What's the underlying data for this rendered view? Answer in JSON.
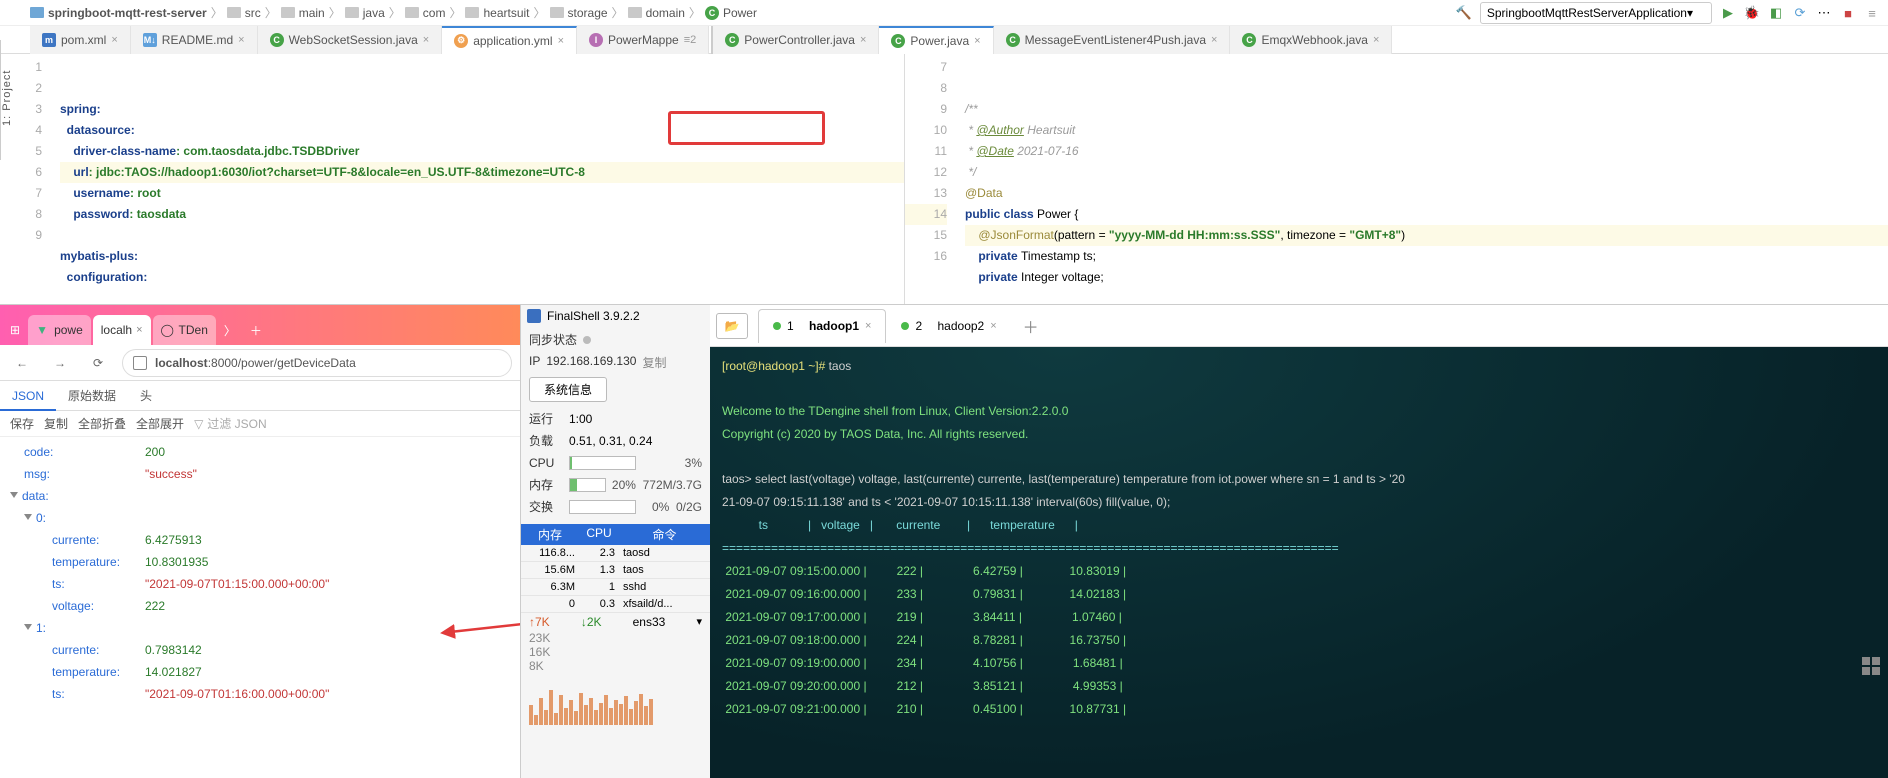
{
  "ide": {
    "sidebar_label": "1: Project",
    "breadcrumbs": [
      "springboot-mqtt-rest-server",
      "src",
      "main",
      "java",
      "com",
      "heartsuit",
      "storage",
      "domain",
      "Power"
    ],
    "run_config": "SpringbootMqttRestServerApplication",
    "editor_tabs_left": [
      {
        "icon": "m",
        "label": "pom.xml",
        "close": true
      },
      {
        "icon": "md",
        "label": "README.md",
        "close": true
      },
      {
        "icon": "c",
        "label": "WebSocketSession.java",
        "close": true
      },
      {
        "icon": "y",
        "label": "application.yml",
        "close": true,
        "active": true
      },
      {
        "icon": "i",
        "label": "PowerMappe",
        "close": true,
        "pin": "≡2"
      }
    ],
    "editor_tabs_right": [
      {
        "icon": "c",
        "label": "PowerController.java",
        "close": true
      },
      {
        "icon": "c",
        "label": "Power.java",
        "close": true,
        "active": true
      },
      {
        "icon": "c",
        "label": "MessageEventListener4Push.java",
        "close": true
      },
      {
        "icon": "c",
        "label": "EmqxWebhook.java",
        "close": true
      }
    ],
    "yml": {
      "lines_no": [
        "1",
        "2",
        "3",
        "4",
        "5",
        "6",
        "7",
        "8",
        "9"
      ],
      "l1": "spring:",
      "l2": "  datasource:",
      "l3a": "    driver-class-name",
      "l3b": ": com.taosdata.jdbc.TSDBDriver",
      "l4a": "    url",
      "l4b": ": jdbc:TAOS://hadoop1:6030/iot?charset=UTF-8&locale=en_US.UTF-8&timezone=UTC-8",
      "l5a": "    username",
      "l5b": ": root",
      "l6a": "    password",
      "l6b": ": taosdata",
      "l7": "",
      "l8": "mybatis-plus:",
      "l9": "  configuration:"
    },
    "java": {
      "lines_no": [
        "7",
        "8",
        "9",
        "10",
        "11",
        "12",
        "13",
        "14",
        "15",
        "16"
      ],
      "l8": "/**",
      "l9a": " * ",
      "l9b": "@Author",
      "l9c": " Heartsuit",
      "l10a": " * ",
      "l10b": "@Date",
      "l10c": " 2021-07-16",
      "l11": " */",
      "l12": "@Data",
      "l13a": "public class ",
      "l13b": "Power {",
      "l14a": "    @JsonFormat",
      "l14b": "(pattern = ",
      "l14c": "\"yyyy-MM-dd HH:mm:ss.SSS\"",
      "l14d": ", timezone = ",
      "l14e": "\"GMT+8\"",
      "l14f": ")",
      "l15a": "    private ",
      "l15b": "Timestamp ts;",
      "l16a": "    private ",
      "l16b": "Integer voltage;"
    }
  },
  "browser": {
    "tabs": [
      {
        "label": "powe",
        "kind": "vue"
      },
      {
        "label": "localh",
        "kind": "page",
        "active": true
      },
      {
        "label": "TDen",
        "kind": "gh"
      }
    ],
    "url_host": "localhost",
    "url_rest": ":8000/power/getDeviceData",
    "json_tabs": [
      "JSON",
      "原始数据",
      "头"
    ],
    "tools": [
      "保存",
      "复制",
      "全部折叠",
      "全部展开"
    ],
    "filter_placeholder": "过滤 JSON",
    "json": {
      "code_k": "code:",
      "code_v": "200",
      "msg_k": "msg:",
      "msg_v": "\"success\"",
      "data_k": "data:",
      "i0": "0:",
      "i0_cur_k": "currente:",
      "i0_cur_v": "6.4275913",
      "i0_tmp_k": "temperature:",
      "i0_tmp_v": "10.8301935",
      "i0_ts_k": "ts:",
      "i0_ts_v": "\"2021-09-07T01:15:00.000+00:00\"",
      "i0_vol_k": "voltage:",
      "i0_vol_v": "222",
      "i1": "1:",
      "i1_cur_k": "currente:",
      "i1_cur_v": "0.7983142",
      "i1_tmp_k": "temperature:",
      "i1_tmp_v": "14.021827",
      "i1_ts_k": "ts:",
      "i1_ts_v": "\"2021-09-07T01:16:00.000+00:00\""
    }
  },
  "fshell": {
    "title": "FinalShell 3.9.2.2",
    "sync": "同步状态",
    "ip_label": "IP",
    "ip": "192.168.169.130",
    "copy": "复制",
    "sysinfo": "系统信息",
    "run_lbl": "运行",
    "run_val": "1:00",
    "load_lbl": "负载",
    "load_val": "0.51, 0.31, 0.24",
    "cpu_lbl": "CPU",
    "cpu_pct": "3%",
    "mem_lbl": "内存",
    "mem_pct": "20%",
    "mem_val": "772M/3.7G",
    "swap_lbl": "交换",
    "swap_pct": "0%",
    "swap_val": "0/2G",
    "pt_hdr": [
      "内存",
      "CPU",
      "命令"
    ],
    "pt_rows": [
      [
        "116.8...",
        "2.3",
        "taosd"
      ],
      [
        "15.6M",
        "1.3",
        "taos"
      ],
      [
        "6.3M",
        "1",
        "sshd"
      ],
      [
        "0",
        "0.3",
        "xfsaild/d..."
      ]
    ],
    "net_up": "↑7K",
    "net_dn": "↓2K",
    "net_if": "ens33",
    "scale": [
      "23K",
      "16K",
      "8K"
    ]
  },
  "term": {
    "tabs": [
      {
        "dot": "g",
        "num": "1",
        "label": "hadoop1",
        "active": true
      },
      {
        "dot": "g",
        "num": "2",
        "label": "hadoop2"
      }
    ],
    "prompt": "[root@hadoop1 ~]# ",
    "cmd0": "taos",
    "welcome1": "Welcome to the TDengine shell from Linux, Client Version:2.2.0.0",
    "welcome2": "Copyright (c) 2020 by TAOS Data, Inc. All rights reserved.",
    "sql1": "taos> select last(voltage) voltage, last(currente) currente, last(temperature) temperature from iot.power where sn = 1 and ts > '20",
    "sql2": "21-09-07 09:15:11.138' and ts < '2021-09-07 10:15:11.138' interval(60s) fill(value, 0);",
    "hdr": "           ts            |   voltage   |       currente        |      temperature      |",
    "sep": "========================================================================================",
    "rows": [
      " 2021-09-07 09:15:00.000 |         222 |               6.42759 |              10.83019 |",
      " 2021-09-07 09:16:00.000 |         233 |               0.79831 |              14.02183 |",
      " 2021-09-07 09:17:00.000 |         219 |               3.84411 |               1.07460 |",
      " 2021-09-07 09:18:00.000 |         224 |               8.78281 |              16.73750 |",
      " 2021-09-07 09:19:00.000 |         234 |               4.10756 |               1.68481 |",
      " 2021-09-07 09:20:00.000 |         212 |               3.85121 |               4.99353 |",
      " 2021-09-07 09:21:00.000 |         210 |               0.45100 |              10.87731 |"
    ]
  }
}
